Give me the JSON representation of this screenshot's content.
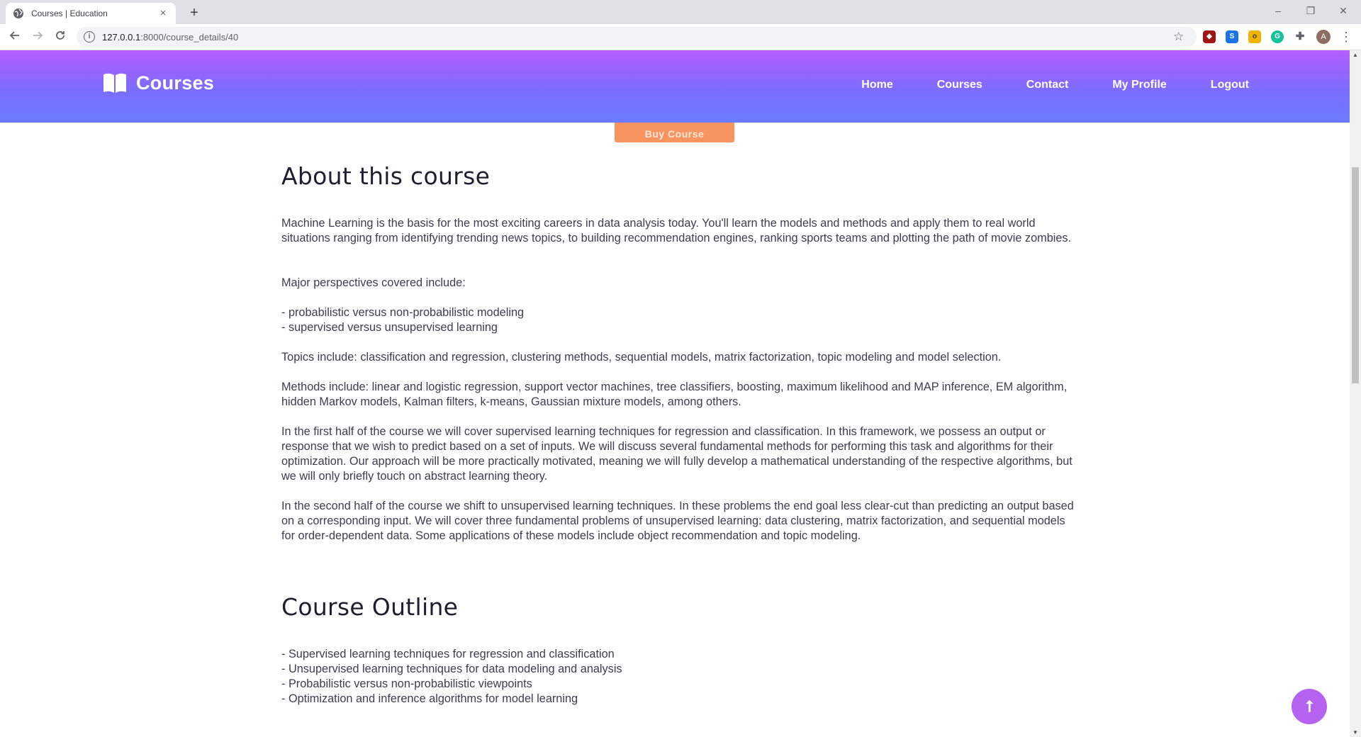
{
  "browser": {
    "tab_title": "Courses | Education",
    "tab_close": "×",
    "new_tab": "+",
    "url_host": "127.0.0.1",
    "url_rest": ":8000/course_details/40",
    "window_controls": [
      "–",
      "❐",
      "✕"
    ],
    "profile_initial": "A"
  },
  "header": {
    "brand": "Courses",
    "nav": [
      "Home",
      "Courses",
      "Contact",
      "My Profile",
      "Logout"
    ]
  },
  "buy_button": "Buy Course",
  "about": {
    "heading": "About this course",
    "paragraphs": [
      "Machine Learning is the basis for the most exciting careers in data analysis today. You'll learn the models and methods and apply them to real world situations ranging from identifying trending news topics, to building recommendation engines, ranking sports teams and plotting the path of movie zombies.",
      "Major perspectives covered include:",
      "- probabilistic versus non-probabilistic modeling\n- supervised versus unsupervised learning",
      "Topics include: classification and regression, clustering methods, sequential models, matrix factorization, topic modeling and model selection.",
      "Methods include: linear and logistic regression, support vector machines, tree classifiers, boosting, maximum likelihood and MAP inference, EM algorithm, hidden Markov models, Kalman filters, k-means, Gaussian mixture models, among others.",
      "In the first half of the course we will cover supervised learning techniques for regression and classification. In this framework, we possess an output or response that we wish to predict based on a set of inputs. We will discuss several fundamental methods for performing this task and algorithms for their optimization. Our approach will be more practically motivated, meaning we will fully develop a mathematical understanding of the respective algorithms, but we will only briefly touch on abstract learning theory.",
      "In the second half of the course we shift to unsupervised learning techniques. In these problems the end goal less clear-cut than predicting an output based on a corresponding input. We will cover three fundamental problems of unsupervised learning: data clustering, matrix factorization, and sequential models for order-dependent data. Some applications of these models include object recommendation and topic modeling."
    ]
  },
  "outline": {
    "heading": "Course Outline",
    "text": "- Supervised learning techniques for regression and classification\n- Unsupervised learning techniques for data modeling and analysis\n- Probabilistic versus non-probabilistic viewpoints\n- Optimization and inference algorithms for model learning"
  },
  "scroll_top_icon": "⭡",
  "colors": {
    "header_gradient_top": "#b45cff",
    "header_gradient_bottom": "#6a7bff",
    "buy_button": "#f7945f",
    "scroll_top": "#b562f0"
  }
}
